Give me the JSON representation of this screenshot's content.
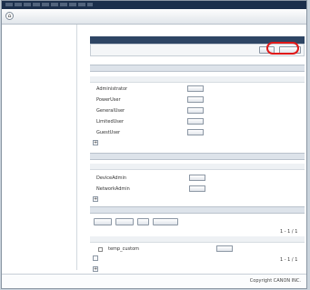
{
  "topbar": {
    "right_text": ""
  },
  "titlebar": {
    "title": ""
  },
  "sidebar": {
    "items": [
      {
        "label": ""
      },
      {
        "label": ""
      },
      {
        "label": ""
      },
      {
        "label": ""
      },
      {
        "label": ""
      },
      {
        "label": ""
      }
    ]
  },
  "breadcrumb": "",
  "header": {
    "title": "",
    "right": ""
  },
  "toolbar": {
    "import_label": "",
    "export_label": ""
  },
  "builtin": {
    "title": "",
    "col_name": "",
    "col_note": "",
    "rows": [
      {
        "name": "Administrator",
        "edit": ""
      },
      {
        "name": "PowerUser",
        "edit": ""
      },
      {
        "name": "GeneralUser",
        "edit": ""
      },
      {
        "name": "LimitedUser",
        "edit": ""
      },
      {
        "name": "GuestUser",
        "edit": ""
      }
    ],
    "expand": "+"
  },
  "custom_admin": {
    "title": "",
    "col_name": "",
    "col_note": "",
    "rows": [
      {
        "name": "DeviceAdmin",
        "edit": ""
      },
      {
        "name": "NetworkAdmin",
        "edit": ""
      }
    ],
    "expand": "+"
  },
  "custom_general": {
    "title": "",
    "btn_select_all": "",
    "btn_clear_all": "",
    "btn_delete": "",
    "btn_add": "",
    "pagination_top": "1 - 1 / 1",
    "col_name": "",
    "col_note": "",
    "rows": [
      {
        "name": "temp_custom",
        "edit": ""
      }
    ],
    "pagination_bottom": "1 - 1 / 1",
    "expand": "+"
  },
  "footer": {
    "copyright": "Copyright CANON INC."
  },
  "colors": {
    "header_bg": "#2e4564",
    "topbar_bg": "#1b2f4b",
    "highlight": "#e01919"
  }
}
